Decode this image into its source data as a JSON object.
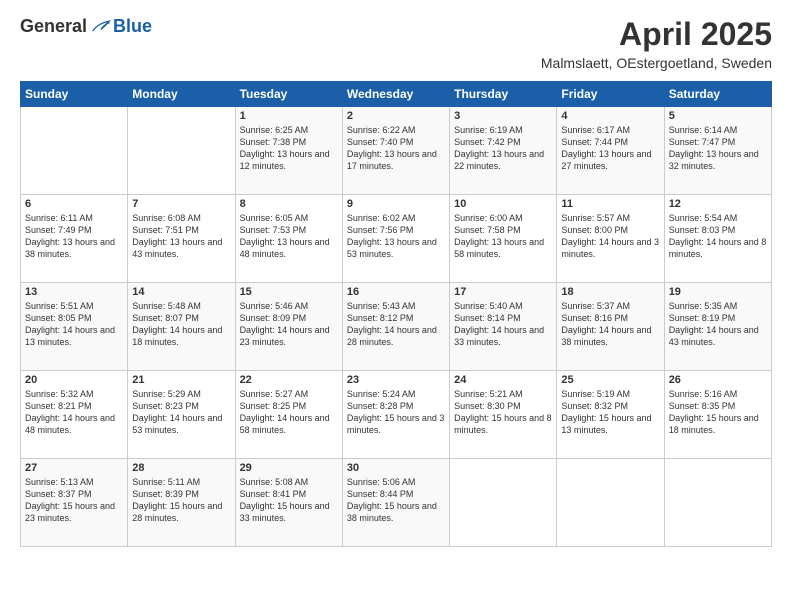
{
  "logo": {
    "general": "General",
    "blue": "Blue"
  },
  "header": {
    "title": "April 2025",
    "subtitle": "Malmslaett, OEstergoetland, Sweden"
  },
  "days_of_week": [
    "Sunday",
    "Monday",
    "Tuesday",
    "Wednesday",
    "Thursday",
    "Friday",
    "Saturday"
  ],
  "weeks": [
    [
      {
        "day": "",
        "sunrise": "",
        "sunset": "",
        "daylight": ""
      },
      {
        "day": "",
        "sunrise": "",
        "sunset": "",
        "daylight": ""
      },
      {
        "day": "1",
        "sunrise": "Sunrise: 6:25 AM",
        "sunset": "Sunset: 7:38 PM",
        "daylight": "Daylight: 13 hours and 12 minutes."
      },
      {
        "day": "2",
        "sunrise": "Sunrise: 6:22 AM",
        "sunset": "Sunset: 7:40 PM",
        "daylight": "Daylight: 13 hours and 17 minutes."
      },
      {
        "day": "3",
        "sunrise": "Sunrise: 6:19 AM",
        "sunset": "Sunset: 7:42 PM",
        "daylight": "Daylight: 13 hours and 22 minutes."
      },
      {
        "day": "4",
        "sunrise": "Sunrise: 6:17 AM",
        "sunset": "Sunset: 7:44 PM",
        "daylight": "Daylight: 13 hours and 27 minutes."
      },
      {
        "day": "5",
        "sunrise": "Sunrise: 6:14 AM",
        "sunset": "Sunset: 7:47 PM",
        "daylight": "Daylight: 13 hours and 32 minutes."
      }
    ],
    [
      {
        "day": "6",
        "sunrise": "Sunrise: 6:11 AM",
        "sunset": "Sunset: 7:49 PM",
        "daylight": "Daylight: 13 hours and 38 minutes."
      },
      {
        "day": "7",
        "sunrise": "Sunrise: 6:08 AM",
        "sunset": "Sunset: 7:51 PM",
        "daylight": "Daylight: 13 hours and 43 minutes."
      },
      {
        "day": "8",
        "sunrise": "Sunrise: 6:05 AM",
        "sunset": "Sunset: 7:53 PM",
        "daylight": "Daylight: 13 hours and 48 minutes."
      },
      {
        "day": "9",
        "sunrise": "Sunrise: 6:02 AM",
        "sunset": "Sunset: 7:56 PM",
        "daylight": "Daylight: 13 hours and 53 minutes."
      },
      {
        "day": "10",
        "sunrise": "Sunrise: 6:00 AM",
        "sunset": "Sunset: 7:58 PM",
        "daylight": "Daylight: 13 hours and 58 minutes."
      },
      {
        "day": "11",
        "sunrise": "Sunrise: 5:57 AM",
        "sunset": "Sunset: 8:00 PM",
        "daylight": "Daylight: 14 hours and 3 minutes."
      },
      {
        "day": "12",
        "sunrise": "Sunrise: 5:54 AM",
        "sunset": "Sunset: 8:03 PM",
        "daylight": "Daylight: 14 hours and 8 minutes."
      }
    ],
    [
      {
        "day": "13",
        "sunrise": "Sunrise: 5:51 AM",
        "sunset": "Sunset: 8:05 PM",
        "daylight": "Daylight: 14 hours and 13 minutes."
      },
      {
        "day": "14",
        "sunrise": "Sunrise: 5:48 AM",
        "sunset": "Sunset: 8:07 PM",
        "daylight": "Daylight: 14 hours and 18 minutes."
      },
      {
        "day": "15",
        "sunrise": "Sunrise: 5:46 AM",
        "sunset": "Sunset: 8:09 PM",
        "daylight": "Daylight: 14 hours and 23 minutes."
      },
      {
        "day": "16",
        "sunrise": "Sunrise: 5:43 AM",
        "sunset": "Sunset: 8:12 PM",
        "daylight": "Daylight: 14 hours and 28 minutes."
      },
      {
        "day": "17",
        "sunrise": "Sunrise: 5:40 AM",
        "sunset": "Sunset: 8:14 PM",
        "daylight": "Daylight: 14 hours and 33 minutes."
      },
      {
        "day": "18",
        "sunrise": "Sunrise: 5:37 AM",
        "sunset": "Sunset: 8:16 PM",
        "daylight": "Daylight: 14 hours and 38 minutes."
      },
      {
        "day": "19",
        "sunrise": "Sunrise: 5:35 AM",
        "sunset": "Sunset: 8:19 PM",
        "daylight": "Daylight: 14 hours and 43 minutes."
      }
    ],
    [
      {
        "day": "20",
        "sunrise": "Sunrise: 5:32 AM",
        "sunset": "Sunset: 8:21 PM",
        "daylight": "Daylight: 14 hours and 48 minutes."
      },
      {
        "day": "21",
        "sunrise": "Sunrise: 5:29 AM",
        "sunset": "Sunset: 8:23 PM",
        "daylight": "Daylight: 14 hours and 53 minutes."
      },
      {
        "day": "22",
        "sunrise": "Sunrise: 5:27 AM",
        "sunset": "Sunset: 8:25 PM",
        "daylight": "Daylight: 14 hours and 58 minutes."
      },
      {
        "day": "23",
        "sunrise": "Sunrise: 5:24 AM",
        "sunset": "Sunset: 8:28 PM",
        "daylight": "Daylight: 15 hours and 3 minutes."
      },
      {
        "day": "24",
        "sunrise": "Sunrise: 5:21 AM",
        "sunset": "Sunset: 8:30 PM",
        "daylight": "Daylight: 15 hours and 8 minutes."
      },
      {
        "day": "25",
        "sunrise": "Sunrise: 5:19 AM",
        "sunset": "Sunset: 8:32 PM",
        "daylight": "Daylight: 15 hours and 13 minutes."
      },
      {
        "day": "26",
        "sunrise": "Sunrise: 5:16 AM",
        "sunset": "Sunset: 8:35 PM",
        "daylight": "Daylight: 15 hours and 18 minutes."
      }
    ],
    [
      {
        "day": "27",
        "sunrise": "Sunrise: 5:13 AM",
        "sunset": "Sunset: 8:37 PM",
        "daylight": "Daylight: 15 hours and 23 minutes."
      },
      {
        "day": "28",
        "sunrise": "Sunrise: 5:11 AM",
        "sunset": "Sunset: 8:39 PM",
        "daylight": "Daylight: 15 hours and 28 minutes."
      },
      {
        "day": "29",
        "sunrise": "Sunrise: 5:08 AM",
        "sunset": "Sunset: 8:41 PM",
        "daylight": "Daylight: 15 hours and 33 minutes."
      },
      {
        "day": "30",
        "sunrise": "Sunrise: 5:06 AM",
        "sunset": "Sunset: 8:44 PM",
        "daylight": "Daylight: 15 hours and 38 minutes."
      },
      {
        "day": "",
        "sunrise": "",
        "sunset": "",
        "daylight": ""
      },
      {
        "day": "",
        "sunrise": "",
        "sunset": "",
        "daylight": ""
      },
      {
        "day": "",
        "sunrise": "",
        "sunset": "",
        "daylight": ""
      }
    ]
  ]
}
